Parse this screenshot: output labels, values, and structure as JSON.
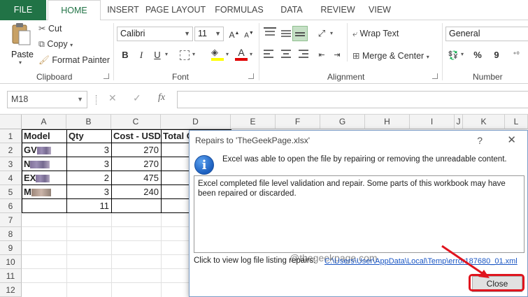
{
  "ribbon_tabs": [
    "FILE",
    "HOME",
    "INSERT",
    "PAGE LAYOUT",
    "FORMULAS",
    "DATA",
    "REVIEW",
    "VIEW"
  ],
  "clipboard": {
    "paste": "Paste",
    "cut": "Cut",
    "copy": "Copy",
    "format_painter": "Format Painter",
    "label": "Clipboard"
  },
  "font": {
    "name": "Calibri",
    "size": "11",
    "bold": "B",
    "italic": "I",
    "underline": "U",
    "font_color": "A",
    "label": "Font"
  },
  "alignment": {
    "wrap_text": "Wrap Text",
    "merge_center": "Merge & Center",
    "label": "Alignment"
  },
  "number": {
    "format": "General",
    "percent": "%",
    "comma": "9",
    "label": "Number"
  },
  "formula_bar": {
    "name_box": "M18",
    "fx": "fx",
    "cancel": "✕",
    "enter": "✓"
  },
  "columns": [
    "A",
    "B",
    "C",
    "D",
    "E",
    "F",
    "G",
    "H",
    "I",
    "J",
    "K",
    "L"
  ],
  "rows": [
    "1",
    "2",
    "3",
    "4",
    "5",
    "6",
    "7",
    "8",
    "9",
    "10",
    "11",
    "12"
  ],
  "sheet": {
    "headers": {
      "model": "Model",
      "qty": "Qty",
      "cost": "Cost - USD",
      "total": "Total C"
    },
    "models": [
      "GV",
      "N",
      "EX",
      "M"
    ],
    "qty": [
      "3",
      "3",
      "2",
      "3"
    ],
    "cost": [
      "270",
      "270",
      "475",
      "240"
    ],
    "qty_total": "11"
  },
  "dialog": {
    "title": "Repairs to 'TheGeekPage.xlsx'",
    "help": "?",
    "close_x": "✕",
    "message": "Excel was able to open the file by repairing or removing the unreadable content.",
    "details": "Excel completed file level validation and repair. Some parts of this workbook may have been repaired or discarded.",
    "watermark": "@thegeekpage.com",
    "log_label": "Click to view log file listing repairs:",
    "log_link": "C:\\Users\\User\\AppData\\Local\\Temp\\error187680_01.xml",
    "close_button": "Close"
  },
  "colors": {
    "excel_green": "#217346",
    "highlight": "#e0141e",
    "link": "#1a56c4"
  }
}
